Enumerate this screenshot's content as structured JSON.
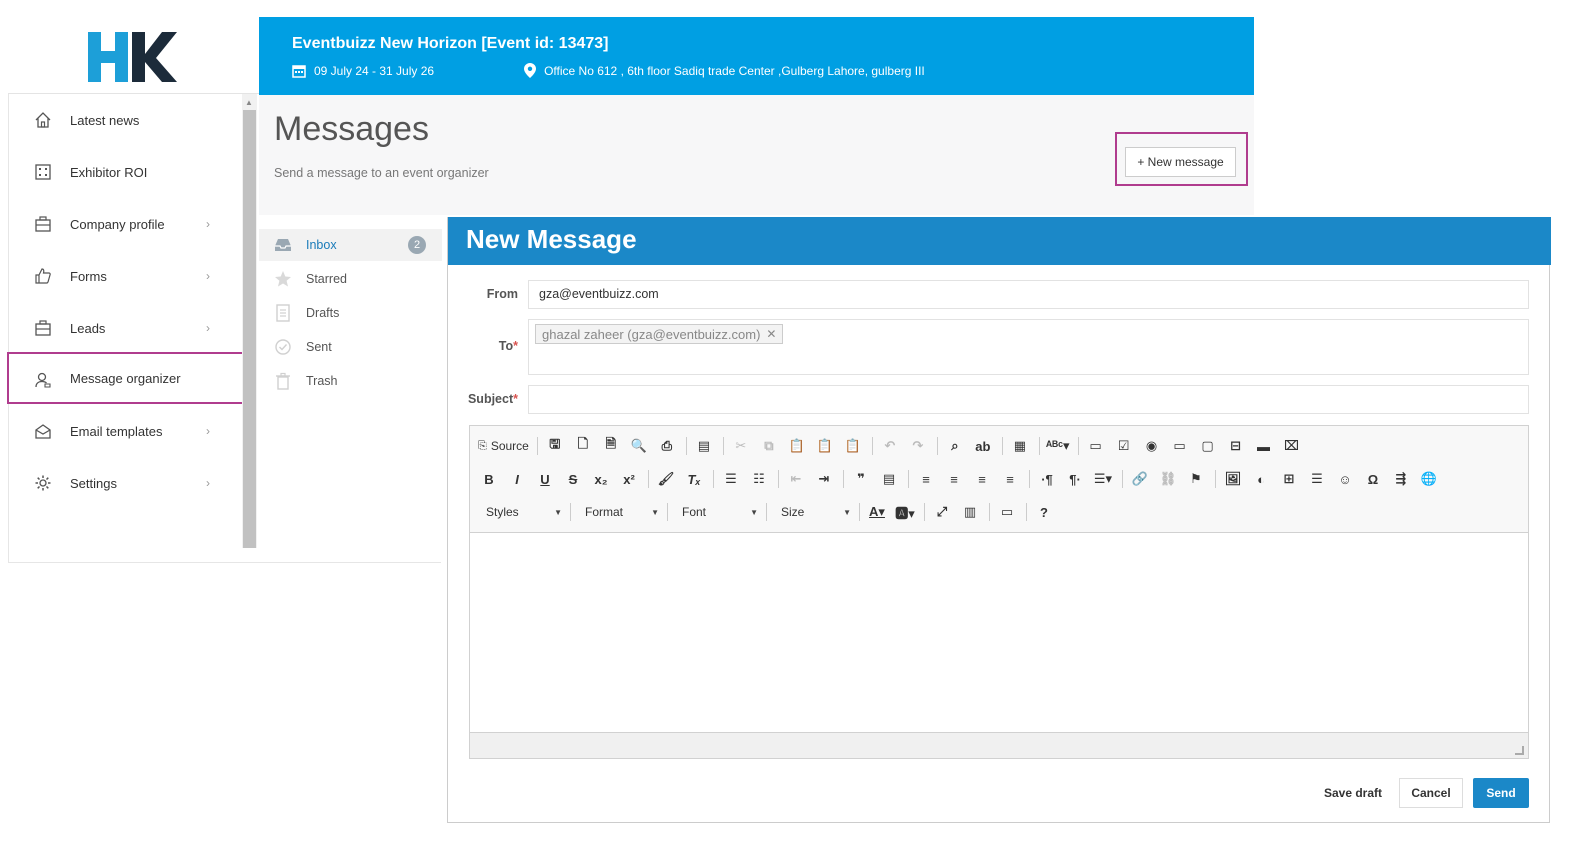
{
  "brand": {
    "logo_text": "HK"
  },
  "event": {
    "title": "Eventbuizz New Horizon [Event id: 13473]",
    "dates": "09 July 24 - 31 July 26",
    "location": "Office No 612 , 6th floor Sadiq trade Center ,Gulberg Lahore, gulberg III"
  },
  "sidebar": {
    "items": [
      {
        "label": "Latest news",
        "icon": "home-icon",
        "has_chevron": false
      },
      {
        "label": "Exhibitor ROI",
        "icon": "grid-icon",
        "has_chevron": false
      },
      {
        "label": "Company profile",
        "icon": "briefcase-icon",
        "has_chevron": true
      },
      {
        "label": "Forms",
        "icon": "thumbs-up-icon",
        "has_chevron": true
      },
      {
        "label": "Leads",
        "icon": "briefcase-icon",
        "has_chevron": true
      },
      {
        "label": "Message organizer",
        "icon": "user-message-icon",
        "has_chevron": false,
        "active": true
      },
      {
        "label": "Email templates",
        "icon": "envelope-open-icon",
        "has_chevron": true
      },
      {
        "label": "Settings",
        "icon": "gear-icon",
        "has_chevron": true
      }
    ],
    "chevron": "›"
  },
  "page": {
    "title": "Messages",
    "subtitle": "Send a message to an event organizer",
    "new_message_label": "+ New message"
  },
  "folders": [
    {
      "label": "Inbox",
      "badge": "2",
      "icon": "inbox-icon"
    },
    {
      "label": "Starred",
      "icon": "star-icon"
    },
    {
      "label": "Drafts",
      "icon": "document-icon"
    },
    {
      "label": "Sent",
      "icon": "check-circle-icon"
    },
    {
      "label": "Trash",
      "icon": "trash-icon"
    }
  ],
  "modal": {
    "title": "New Message",
    "from_label": "From",
    "from_value": "gza@eventbuizz.com",
    "to_label": "To",
    "to_token": "ghazal zaheer (gza@eventbuizz.com)",
    "subject_label": "Subject",
    "required_mark": "*",
    "editor": {
      "source_label": "Source",
      "styles_label": "Styles",
      "format_label": "Format",
      "font_label": "Font",
      "size_label": "Size"
    },
    "buttons": {
      "save_draft": "Save draft",
      "cancel": "Cancel",
      "send": "Send"
    }
  },
  "colors": {
    "header_blue": "#009fe3",
    "modal_blue": "#1b88c8",
    "highlight": "#b03c8e",
    "logo_blue": "#1d9fd8",
    "logo_dark": "#1c2b3a"
  }
}
